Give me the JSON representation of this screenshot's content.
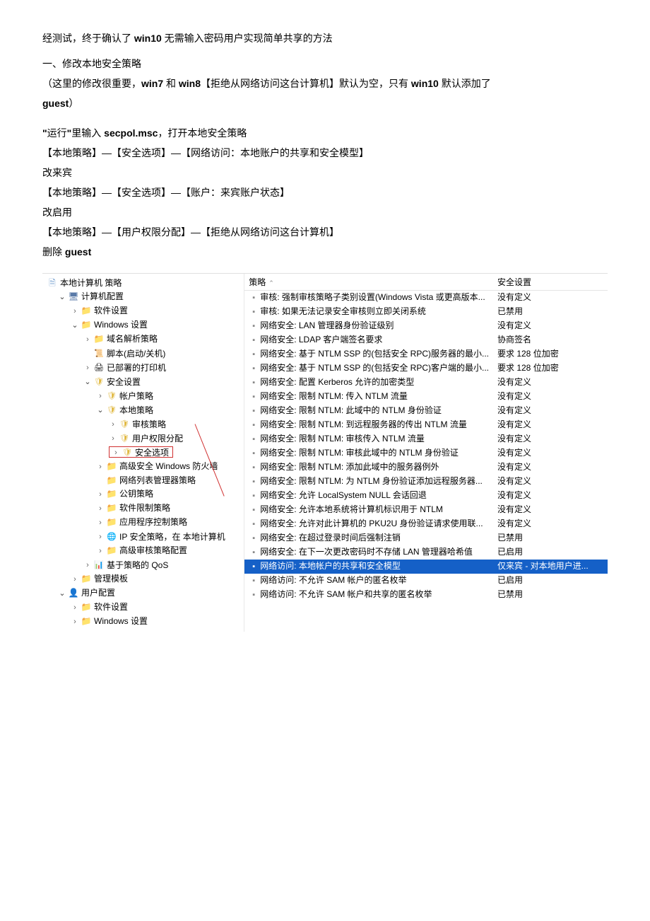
{
  "intro": {
    "l1a": "经测试，终于确认了 ",
    "l1b": "win10",
    "l1c": " 无需输入密码用户实现简单共享的方法",
    "sec1": "一、修改本地安全策略",
    "l2a": "（这里的修改很重要，",
    "l2b": "win7",
    "l2c": " 和 ",
    "l2d": "win8",
    "l2e": "【拒绝从网络访问这台计算机】默认为空，只有 ",
    "l2f": "win10",
    "l2g": " 默认添加了",
    "l2h": "guest",
    "l2i": "）",
    "run1a": "\"",
    "run1b": "运行",
    "run1c": "\"",
    "run1d": "里输入 ",
    "run1e": "secpol.msc",
    "run1f": "，打开本地安全策略",
    "p1": "【本地策略】—【安全选项】—【网络访问：本地账户的共享和安全模型】",
    "p1r": "改来宾",
    "p2": "【本地策略】—【安全选项】—【账户：来宾账户状态】",
    "p2r": "改启用",
    "p3": "【本地策略】—【用户权限分配】—【拒绝从网络访问这台计算机】",
    "p3r": "删除 guest"
  },
  "tree": {
    "root": "本地计算机 策略",
    "computer": "计算机配置",
    "soft1": "软件设置",
    "winset1": "Windows 设置",
    "dns": "域名解析策略",
    "scripts": "脚本(启动/关机)",
    "printers": "已部署的打印机",
    "secset": "安全设置",
    "acct": "帐户策略",
    "local": "本地策略",
    "audit": "审核策略",
    "userrights": "用户权限分配",
    "secopt": "安全选项",
    "fw": "高级安全 Windows 防火墙",
    "nlm": "网络列表管理器策略",
    "pubkey": "公钥策略",
    "restrict": "软件限制策略",
    "appctrl": "应用程序控制策略",
    "ipsec": "IP 安全策略，在 本地计算机",
    "advaudit": "高级审核策略配置",
    "qos": "基于策略的 QoS",
    "admtpl": "管理模板",
    "user": "用户配置",
    "soft2": "软件设置",
    "winset2": "Windows 设置"
  },
  "cols": {
    "policy": "策略",
    "setting": "安全设置"
  },
  "rows": [
    {
      "p": "审核: 强制审核策略子类别设置(Windows Vista 或更高版本...",
      "s": "没有定义"
    },
    {
      "p": "审核: 如果无法记录安全审核则立即关闭系统",
      "s": "已禁用"
    },
    {
      "p": "网络安全: LAN 管理器身份验证级别",
      "s": "没有定义"
    },
    {
      "p": "网络安全: LDAP 客户端签名要求",
      "s": "协商签名"
    },
    {
      "p": "网络安全: 基于 NTLM SSP 的(包括安全 RPC)服务器的最小...",
      "s": "要求 128 位加密"
    },
    {
      "p": "网络安全: 基于 NTLM SSP 的(包括安全 RPC)客户端的最小...",
      "s": "要求 128 位加密"
    },
    {
      "p": "网络安全: 配置 Kerberos 允许的加密类型",
      "s": "没有定义"
    },
    {
      "p": "网络安全: 限制 NTLM: 传入 NTLM 流量",
      "s": "没有定义"
    },
    {
      "p": "网络安全: 限制 NTLM: 此域中的 NTLM 身份验证",
      "s": "没有定义"
    },
    {
      "p": "网络安全: 限制 NTLM: 到远程服务器的传出 NTLM 流量",
      "s": "没有定义"
    },
    {
      "p": "网络安全: 限制 NTLM: 审核传入 NTLM 流量",
      "s": "没有定义"
    },
    {
      "p": "网络安全: 限制 NTLM: 审核此域中的 NTLM 身份验证",
      "s": "没有定义"
    },
    {
      "p": "网络安全: 限制 NTLM: 添加此域中的服务器例外",
      "s": "没有定义"
    },
    {
      "p": "网络安全: 限制 NTLM: 为 NTLM 身份验证添加远程服务器...",
      "s": "没有定义"
    },
    {
      "p": "网络安全: 允许 LocalSystem NULL 会话回退",
      "s": "没有定义"
    },
    {
      "p": "网络安全: 允许本地系统将计算机标识用于 NTLM",
      "s": "没有定义"
    },
    {
      "p": "网络安全: 允许对此计算机的 PKU2U 身份验证请求使用联...",
      "s": "没有定义"
    },
    {
      "p": "网络安全: 在超过登录时间后强制注销",
      "s": "已禁用"
    },
    {
      "p": "网络安全: 在下一次更改密码时不存储 LAN 管理器哈希值",
      "s": "已启用"
    },
    {
      "p": "网络访问: 本地帐户的共享和安全模型",
      "s": "仅来宾 - 对本地用户进...",
      "hl": true
    },
    {
      "p": "网络访问: 不允许 SAM 帐户的匿名枚举",
      "s": "已启用"
    },
    {
      "p": "网络访问: 不允许 SAM 帐户和共享的匿名枚举",
      "s": "已禁用"
    }
  ]
}
